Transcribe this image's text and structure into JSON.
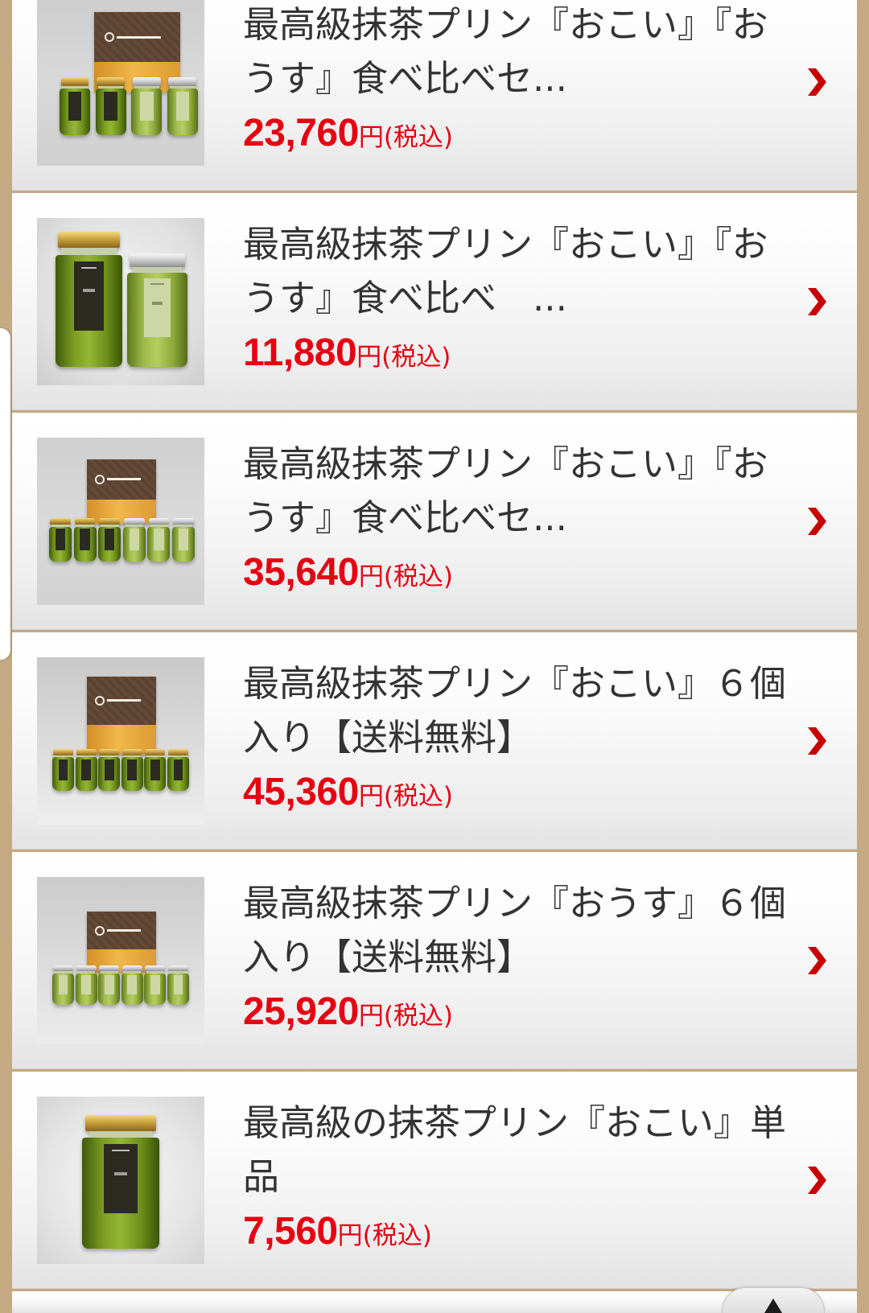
{
  "product_list": {
    "items": [
      {
        "title": "最高級抹茶プリン『おこい』『おうす』食べ比べセ...",
        "price": "23,760",
        "currency": "円",
        "tax_note": "(税込)"
      },
      {
        "title": "最高級抹茶プリン『おこい』『おうす』食べ比べ　...",
        "price": "11,880",
        "currency": "円",
        "tax_note": "(税込)"
      },
      {
        "title": "最高級抹茶プリン『おこい』『おうす』食べ比べセ...",
        "price": "35,640",
        "currency": "円",
        "tax_note": "(税込)"
      },
      {
        "title": "最高級抹茶プリン『おこい』６個入り【送料無料】",
        "price": "45,360",
        "currency": "円",
        "tax_note": "(税込)"
      },
      {
        "title": "最高級抹茶プリン『おうす』６個入り【送料無料】",
        "price": "25,920",
        "currency": "円",
        "tax_note": "(税込)"
      },
      {
        "title": "最高級の抹茶プリン『おこい』単品",
        "price": "7,560",
        "currency": "円",
        "tax_note": "(税込)"
      }
    ]
  },
  "icons": {
    "item_arrow": "chevron-right-icon",
    "scroll_top": "arrow-up-icon"
  },
  "colors": {
    "frame": "#c5a983",
    "price": "#e60012",
    "chevron": "#c80000",
    "title_text": "#333333"
  }
}
